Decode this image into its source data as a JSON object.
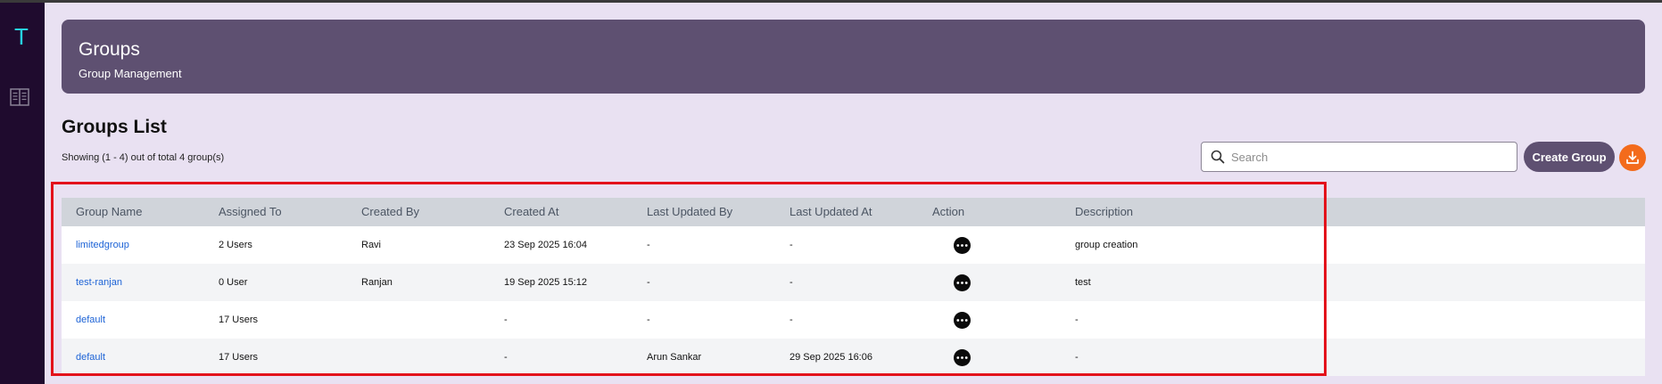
{
  "sidebar": {
    "logo_letter": "T",
    "nav_icon": "book-icon"
  },
  "header": {
    "title": "Groups",
    "subtitle": "Group Management"
  },
  "list": {
    "title": "Groups List",
    "showing": "Showing (1 - 4) out of total 4 group(s)"
  },
  "toolbar": {
    "search_placeholder": "Search",
    "search_icon": "search-icon",
    "create_label": "Create Group",
    "download_icon": "download-icon"
  },
  "table": {
    "columns": [
      "Group Name",
      "Assigned To",
      "Created By",
      "Created At",
      "Last Updated By",
      "Last Updated At",
      "Action",
      "Description"
    ],
    "rows": [
      {
        "name": "limitedgroup",
        "assigned": "2 Users",
        "created_by": "Ravi",
        "created_at": "23 Sep 2025 16:04",
        "updated_by": "-",
        "updated_at": "-",
        "description": "group creation"
      },
      {
        "name": "test-ranjan",
        "assigned": "0 User",
        "created_by": "Ranjan",
        "created_at": "19 Sep 2025 15:12",
        "updated_by": "-",
        "updated_at": "-",
        "description": "test"
      },
      {
        "name": "default",
        "assigned": "17 Users",
        "created_by": "",
        "created_at": "-",
        "updated_by": "-",
        "updated_at": "-",
        "description": "-"
      },
      {
        "name": "default",
        "assigned": "17 Users",
        "created_by": "",
        "created_at": "-",
        "updated_by": "Arun Sankar",
        "updated_at": "29 Sep 2025 16:06",
        "description": "-"
      }
    ]
  },
  "colors": {
    "sidebar": "#1f0b2e",
    "header_card": "#5e5071",
    "accent_orange": "#f36b1c",
    "link": "#1d63d6",
    "highlight_border": "#e3121b"
  }
}
